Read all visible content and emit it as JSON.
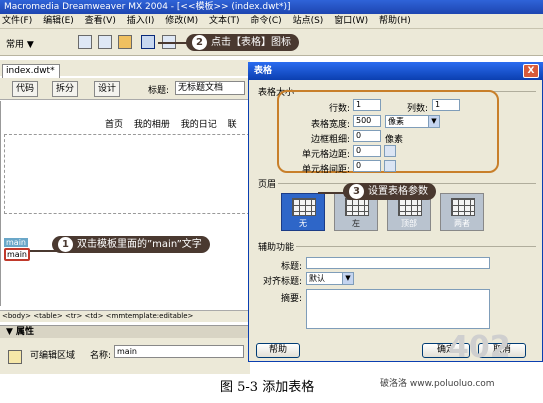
{
  "window": {
    "title": "Macromedia Dreamweaver MX 2004 - [<<模板>> (index.dwt*)]"
  },
  "menu": [
    "文件(F)",
    "编辑(E)",
    "查看(V)",
    "插入(I)",
    "修改(M)",
    "文本(T)",
    "命令(C)",
    "站点(S)",
    "窗口(W)",
    "帮助(H)"
  ],
  "toolbar": {
    "category": "常用"
  },
  "document": {
    "tab": "index.dwt*",
    "view_code": "代码",
    "view_split": "拆分",
    "view_design": "设计",
    "title_label": "标题:",
    "title_value": "无标题文档",
    "nav": [
      "首页",
      "我的相册",
      "我的日记",
      "联"
    ],
    "template_tag": "main",
    "editable_text": "main"
  },
  "status": {
    "tags": "<body> <table> <tr> <td> <mmtemplate:editable>"
  },
  "properties": {
    "header": "▼ 属性",
    "type_label": "可编辑区域",
    "name_label": "名称:",
    "name_value": "main"
  },
  "callouts": {
    "c1": {
      "num": "1",
      "text": "双击模板里面的”main”文字"
    },
    "c2": {
      "num": "2",
      "text": "点击【表格】图标"
    },
    "c3": {
      "num": "3",
      "text": "设置表格参数"
    }
  },
  "dialog": {
    "title": "表格",
    "close": "X",
    "size_group": "表格大小",
    "rows_label": "行数:",
    "rows_value": "1",
    "cols_label": "列数:",
    "cols_value": "1",
    "width_label": "表格宽度:",
    "width_value": "500",
    "width_unit": "像素",
    "border_label": "边框粗细:",
    "border_value": "0",
    "border_unit": "像素",
    "padding_label": "单元格边距:",
    "padding_value": "0",
    "spacing_label": "单元格间距:",
    "spacing_value": "0",
    "header_group": "页眉",
    "header_options": [
      "无",
      "左",
      "顶部",
      "两者"
    ],
    "access_group": "辅助功能",
    "caption_label": "标题:",
    "align_label": "对齐标题:",
    "align_value": "默认",
    "summary_label": "摘要:",
    "help_button": "帮助",
    "ok_button": "确定",
    "cancel_button": "取消"
  },
  "figure": {
    "caption": "图 5-3    添加表格",
    "site": "破洛洛  www.poluoluo.com",
    "big_mark": "402"
  }
}
